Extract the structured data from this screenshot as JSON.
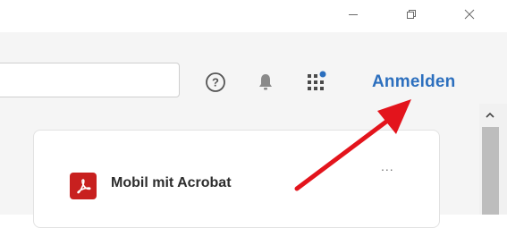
{
  "window_controls": {
    "minimize_icon": "minimize-icon",
    "restore_icon": "restore-icon",
    "close_icon": "close-icon"
  },
  "toolbar": {
    "search_value": "",
    "help_icon": "help-icon",
    "notification_icon": "bell-icon",
    "apps_icon": "apps-grid-icon",
    "apps_badge_color": "#2c6fbe",
    "signin_label": "Anmelden",
    "signin_color": "#2c6fbe"
  },
  "main": {
    "card": {
      "title": "Mobil mit Acrobat",
      "icon": "acrobat-icon",
      "icon_color": "#c8201f",
      "more_label": "..."
    }
  },
  "annotation": {
    "arrow_color": "#e3141c",
    "arrow_icon": "red-arrow-annotation"
  }
}
